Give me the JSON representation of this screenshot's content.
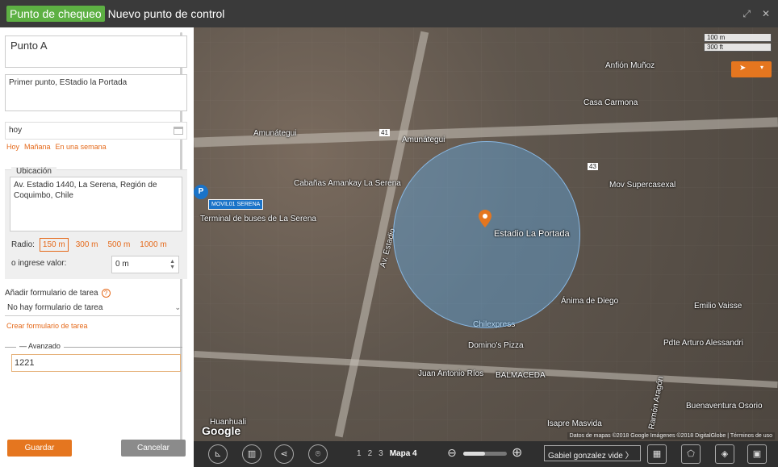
{
  "header": {
    "badge": "Punto de chequeo",
    "title": "Nuevo punto de control",
    "controls": [
      "expand-icon",
      "close-icon"
    ]
  },
  "form": {
    "name_value": "Punto A",
    "description_value": "Primer punto, EStadio la Portada",
    "date_value": "hoy",
    "quick_dates": [
      "Hoy",
      "Mañana",
      "En una semana"
    ],
    "location": {
      "legend": "Ubicación",
      "address": "Av. Estadio 1440, La Serena, Región de Coquimbo, Chile",
      "radius_label": "Radio:",
      "radius_options": [
        "150 m",
        "300 m",
        "500 m",
        "1000 m"
      ],
      "selected_radius": "150 m",
      "custom_label": "o ingrese valor:",
      "custom_value": "0 m"
    },
    "task_form_label": "Añadir formulario de tarea",
    "task_form_select": "No hay formulario de tarea",
    "create_form_link": "Crear formulario de tarea",
    "advanced_legend": "Avanzado",
    "advanced_value": "1221",
    "save_label": "Guardar",
    "cancel_label": "Cancelar"
  },
  "map": {
    "scale": [
      "100 m",
      "300 ft"
    ],
    "labels": {
      "amunategui_left": "Amunátegui",
      "amunategui_right": "Amunátegui",
      "estadio_label": "Estadio La Portada",
      "cabanas": "Cabañas Amankay La Serena",
      "casa_carmona": "Casa Carmona",
      "anfion": "Anfión Muñoz",
      "mov_serena": "MOVIL01 SERENA",
      "terminal_buses": "Terminal de buses de La Serena",
      "super": "Mov Supercasexal",
      "chilexpress": "Chilexpress",
      "dominos": "Domino's Pizza",
      "balmaceda": "BALMACEDA",
      "juan_rios": "Juan Antonio Ríos",
      "isapre": "Isapre Masvida",
      "anima": "Ánima de Diego",
      "pdte": "Pdte Arturo Alessandri",
      "emilio": "Emilio Vaisse",
      "buenaventura": "Buenaventura Osorio",
      "huanhuali": "Huanhuali",
      "av_estadio": "Av. Estadio",
      "ramon_aragon": "Ramón Aragón",
      "route_41": "41",
      "route_43": "43",
      "parking": "P"
    },
    "attribution": "Datos de mapas ©2018 Google Imágenes ©2018 DigitalGlobe | Términos de uso",
    "brand": "Google"
  },
  "toolbar": {
    "pages": [
      "1",
      "2",
      "3",
      "Mapa 4"
    ],
    "current_page": "Mapa 4",
    "zoom_level": 0.5,
    "user": "Gabiel gonzalez vide",
    "tools": [
      "ruler-icon",
      "traffic-icon",
      "share-icon",
      "pin-icon",
      "layer-photo-icon",
      "polygon-icon",
      "layers-icon",
      "minimap-icon"
    ]
  },
  "colors": {
    "accent": "#e5761f",
    "badge": "#5db043",
    "title_bg": "#3a3a3a",
    "radius_fill": "#62a6dd"
  }
}
